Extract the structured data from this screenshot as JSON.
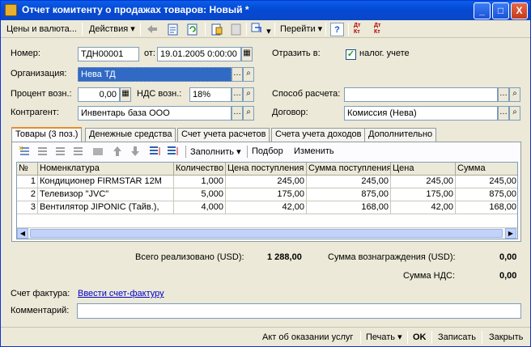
{
  "window": {
    "title": "Отчет комитенту о продажах товаров: Новый *",
    "min": "_",
    "max": "□",
    "close": "X"
  },
  "toolbar": {
    "prices_currency": "Цены и валюта...",
    "actions": "Действия",
    "goto": "Перейти",
    "help": "?",
    "dt_kt_1": "Дт Кт",
    "dt_kt_2": "Дт Кт"
  },
  "header": {
    "number_label": "Номер:",
    "number_value": "ТДН00001",
    "date_label": "от:",
    "date_value": "19.01.2005  0:00:00",
    "reflect_label": "Отразить в:",
    "tax_check_label": "налог. учете",
    "org_label": "Организация:",
    "org_value": "Нева ТД",
    "percent_label": "Процент возн.:",
    "percent_value": "0,00",
    "vat_label": "НДС возн.:",
    "vat_value": "18%",
    "payment_method_label": "Способ расчета:",
    "payment_method_value": "",
    "contractor_label": "Контрагент:",
    "contractor_value": "Инвентарь база ООО",
    "contract_label": "Договор:",
    "contract_value": "Комиссия (Нева)"
  },
  "tabs": [
    "Товары (3 поз.)",
    "Денежные средства",
    "Счет учета расчетов",
    "Счета учета доходов",
    "Дополнительно"
  ],
  "grid_toolbar": {
    "fill": "Заполнить",
    "select": "Подбор",
    "change": "Изменить"
  },
  "table": {
    "columns": [
      "№",
      "Номенклатура",
      "Количество",
      "Цена поступления",
      "Сумма поступления",
      "Цена",
      "Сумма"
    ],
    "rows": [
      [
        "1",
        "Кондиционер FIRMSTAR 12M",
        "1,000",
        "245,00",
        "245,00",
        "245,00",
        "245,00"
      ],
      [
        "2",
        "Телевизор \"JVC\"",
        "5,000",
        "175,00",
        "875,00",
        "175,00",
        "875,00"
      ],
      [
        "3",
        "Вентилятор JIPONIC (Тайв.),",
        "4,000",
        "42,00",
        "168,00",
        "42,00",
        "168,00"
      ]
    ]
  },
  "totals": {
    "total_sold_label": "Всего реализовано (USD):",
    "total_sold_value": "1 288,00",
    "reward_label": "Сумма вознаграждения (USD):",
    "reward_value": "0,00",
    "vat_sum_label": "Сумма НДС:",
    "vat_sum_value": "0,00"
  },
  "invoice": {
    "label": "Счет фактура:",
    "link": "Ввести счет-фактуру"
  },
  "comment": {
    "label": "Комментарий:",
    "value": ""
  },
  "bottom": {
    "act": "Акт об оказании услуг",
    "print": "Печать",
    "ok": "OK",
    "save": "Записать",
    "close": "Закрыть"
  },
  "colors": {
    "title_bar": "#0A5FE8",
    "selection": "#316AC5",
    "window_bg": "#ECE9D8"
  }
}
